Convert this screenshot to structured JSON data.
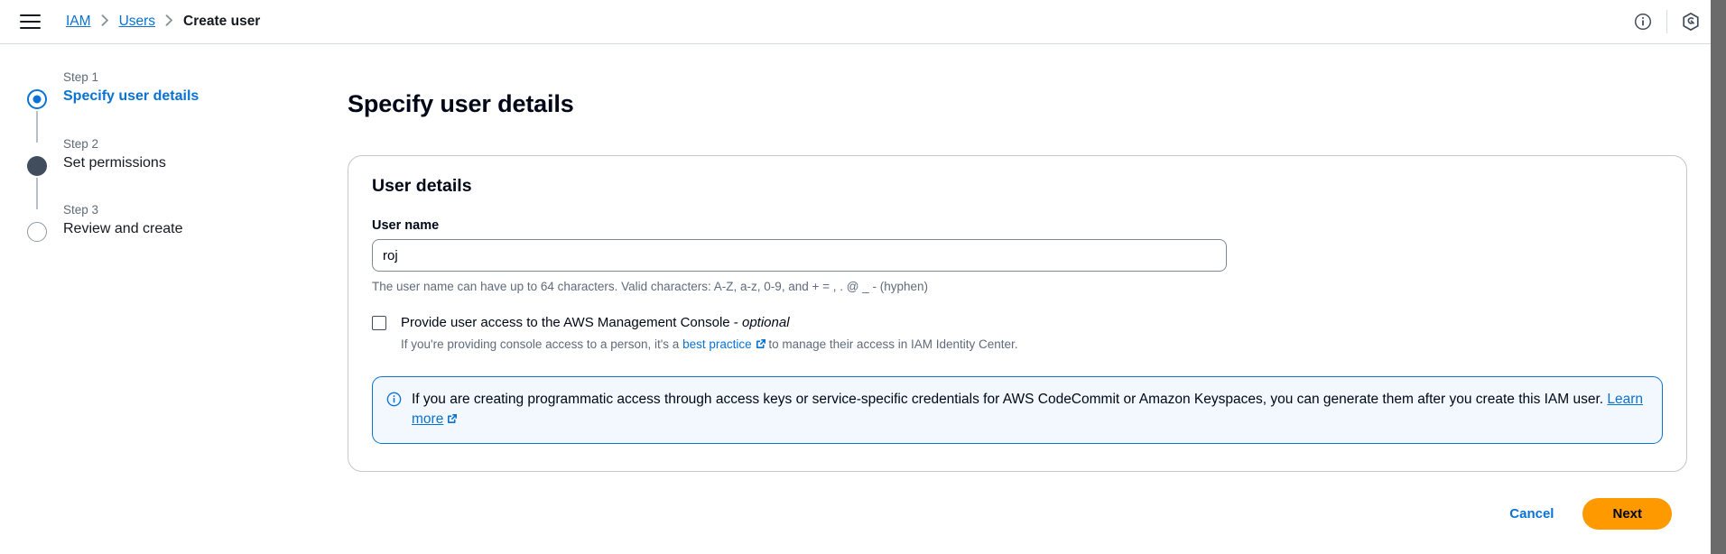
{
  "topbar": {
    "menu_icon": "hamburger-menu-icon",
    "breadcrumb": [
      {
        "label": "IAM",
        "type": "link"
      },
      {
        "label": "Users",
        "type": "link"
      },
      {
        "label": "Create user",
        "type": "current"
      }
    ],
    "separator": "›",
    "info_icon": "info-circle-icon",
    "cloudshell_icon": "cloudshell-hexagon-icon"
  },
  "stepper": {
    "steps": [
      {
        "number": "Step 1",
        "title": "Specify user details",
        "state": "active"
      },
      {
        "number": "Step 2",
        "title": "Set permissions",
        "state": "filled"
      },
      {
        "number": "Step 3",
        "title": "Review and create",
        "state": "empty"
      }
    ]
  },
  "main": {
    "page_title": "Specify user details",
    "card": {
      "title": "User details",
      "user_name_label": "User name",
      "user_name_value": "roj",
      "user_name_placeholder": "",
      "user_name_hint": "The user name can have up to 64 characters. Valid characters: A-Z, a-z, 0-9, and + = , . @ _ - (hyphen)",
      "console_access": {
        "checked": false,
        "label_main": "Provide user access to the AWS Management Console",
        "label_dash": " - ",
        "label_optional": "optional",
        "sub_before": "If you're providing console access to a person, it's a ",
        "sub_link": "best practice",
        "sub_after": " to manage their access in IAM Identity Center."
      },
      "alert": {
        "icon": "info-circle-icon",
        "text_before": "If you are creating programmatic access through access keys or service-specific credentials for AWS CodeCommit or Amazon Keyspaces, you can generate them after you create this IAM user. ",
        "link": "Learn more"
      }
    }
  },
  "footer": {
    "cancel_label": "Cancel",
    "next_label": "Next"
  },
  "colors": {
    "link_blue": "#0972d3",
    "accent_orange": "#ff9900",
    "text_dark": "#000716",
    "text_muted": "#5f6b7a",
    "alert_bg": "#f2f8fd",
    "border": "#c6c6cd"
  }
}
